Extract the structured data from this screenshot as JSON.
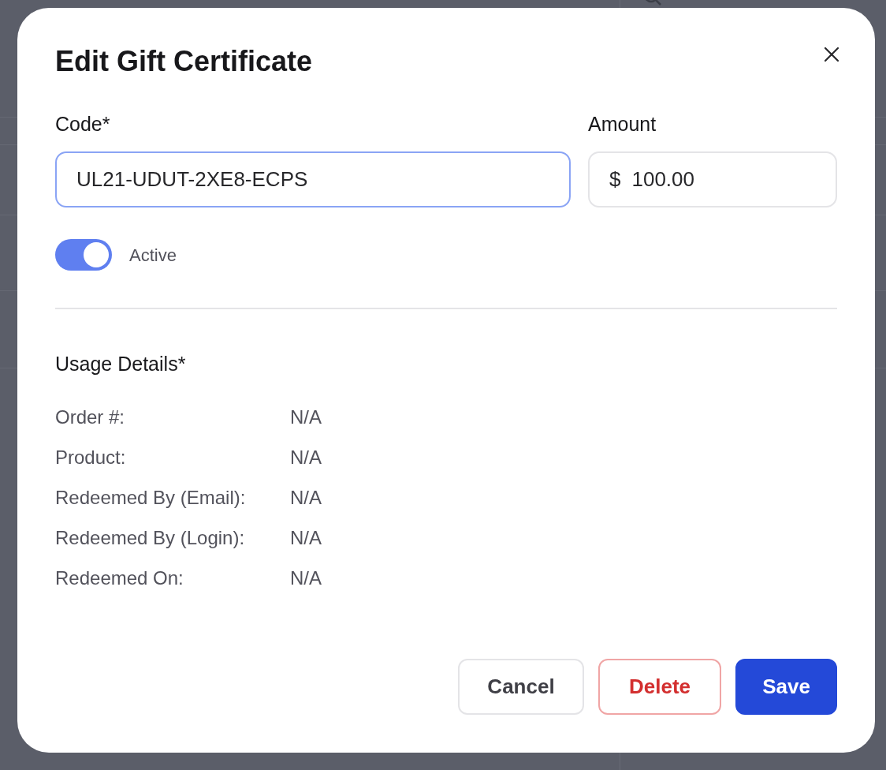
{
  "dialog": {
    "title": "Edit Gift Certificate",
    "fields": [
      {
        "label": "Code*",
        "value": "UL21-UDUT-2XE8-ECPS",
        "focused": true
      },
      {
        "label": "Amount",
        "prefix": "$",
        "value": "100.00",
        "focused": false
      }
    ],
    "active_toggle": {
      "label": "Active",
      "on": true
    },
    "usage_details": {
      "title": "Usage Details*",
      "rows": [
        {
          "label": "Order #:",
          "value": "N/A"
        },
        {
          "label": "Product:",
          "value": "N/A"
        },
        {
          "label": "Redeemed By (Email):",
          "value": "N/A"
        },
        {
          "label": "Redeemed By (Login):",
          "value": "N/A"
        },
        {
          "label": "Redeemed On:",
          "value": "N/A"
        }
      ]
    },
    "buttons": [
      {
        "label": "Cancel",
        "kind": "secondary"
      },
      {
        "label": "Delete",
        "kind": "danger"
      },
      {
        "label": "Save",
        "kind": "primary"
      }
    ]
  }
}
